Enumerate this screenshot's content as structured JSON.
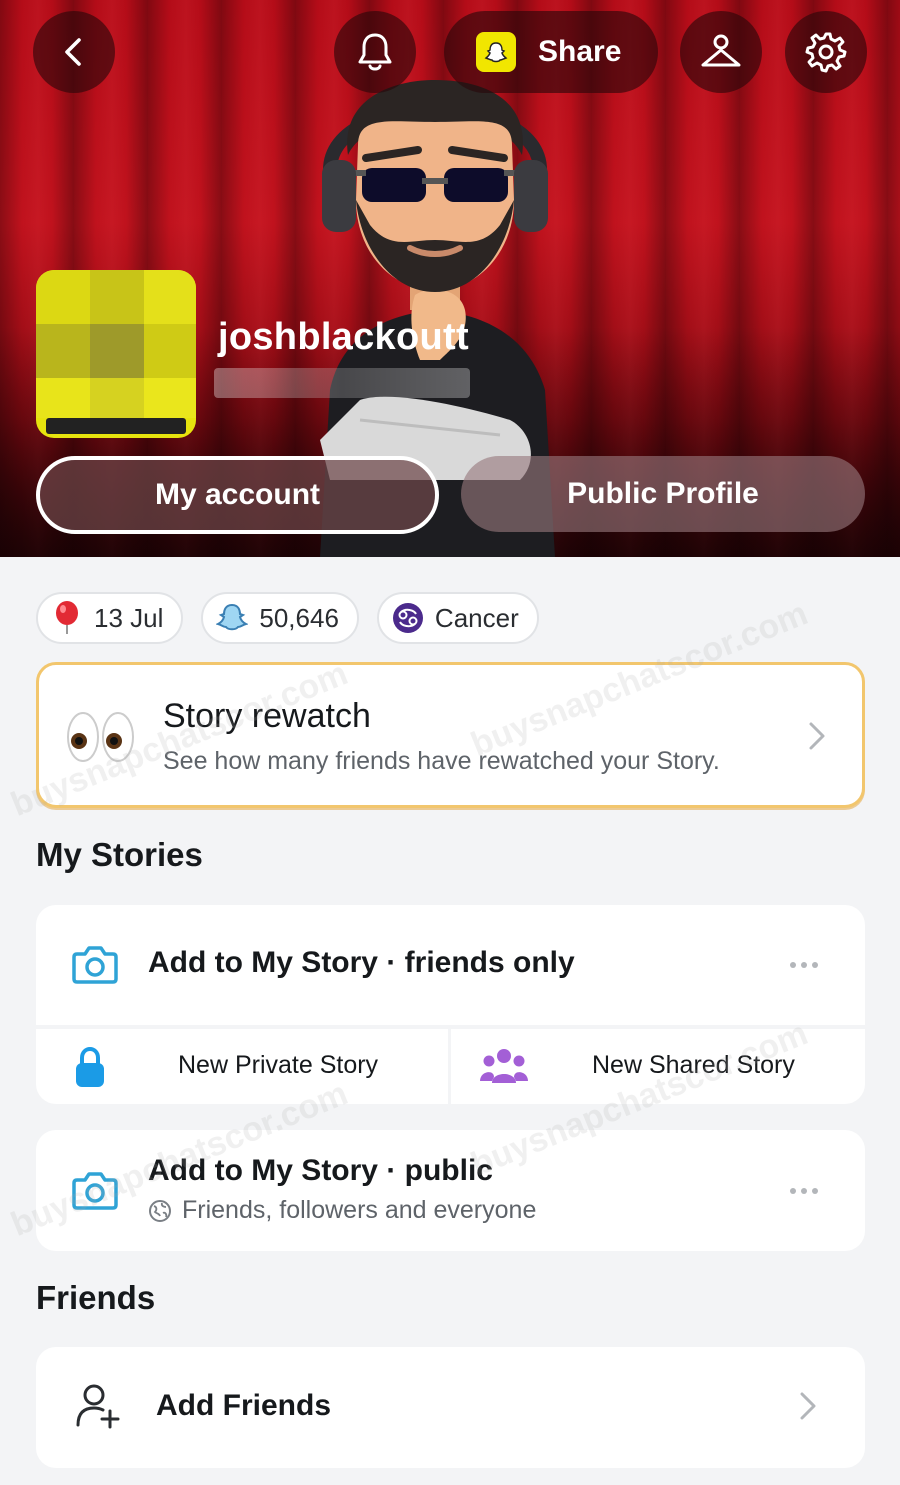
{
  "header": {
    "share_label": "Share",
    "username": "joshblackoutt"
  },
  "buttons": {
    "my_account": "My account",
    "public_profile": "Public Profile"
  },
  "chips": [
    {
      "icon": "balloon-icon",
      "label": "13 Jul"
    },
    {
      "icon": "ghost-score-icon",
      "label": "50,646"
    },
    {
      "icon": "cancer-zodiac-icon",
      "label": "Cancer"
    }
  ],
  "story_rewatch": {
    "title": "Story rewatch",
    "description": "See how many friends have rewatched your Story."
  },
  "my_stories": {
    "section_title": "My Stories",
    "friends_only": {
      "title": "Add to My Story · friends only"
    },
    "private_story": "New Private Story",
    "shared_story": "New Shared Story",
    "public": {
      "title": "Add to My Story · public",
      "subtitle": "Friends, followers and everyone"
    }
  },
  "friends": {
    "section_title": "Friends",
    "add_friends": "Add Friends"
  },
  "watermark": "buysnapchatscor.com",
  "colors": {
    "accent_blue": "#2fa3d6",
    "lock_blue": "#1b9be6",
    "group_purple": "#a35fd6",
    "rewatch_border": "#f2c66d"
  }
}
